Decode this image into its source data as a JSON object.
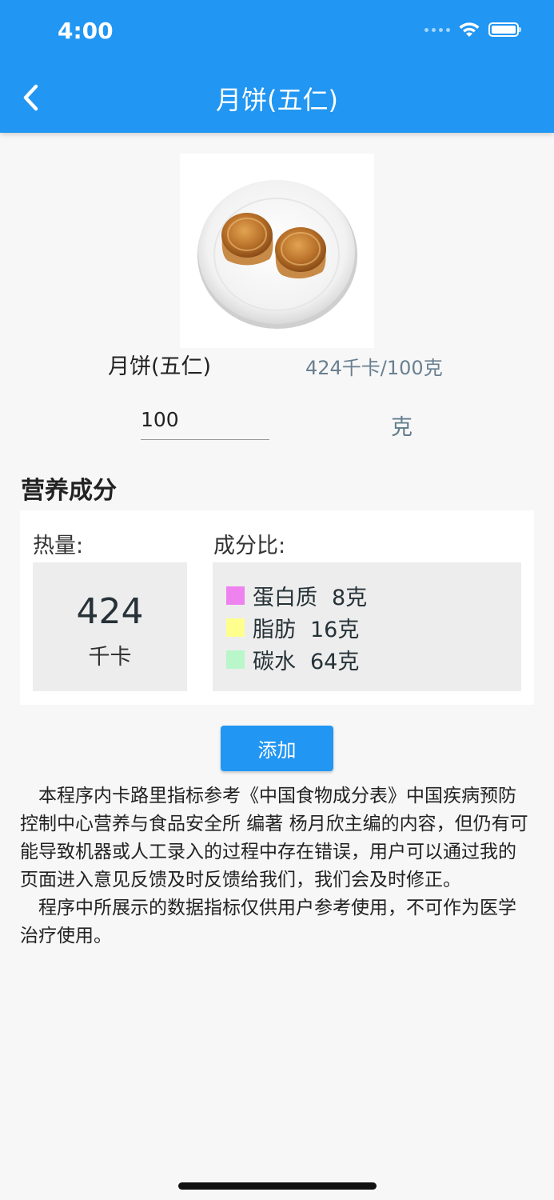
{
  "status_bar": {
    "time": "4:00"
  },
  "header": {
    "title": "月饼(五仁)"
  },
  "food": {
    "image_alt": "月饼(五仁)",
    "name": "月饼(五仁)",
    "calorie_per_100g": "424千卡/100克",
    "quantity_value": "100",
    "quantity_unit": "克"
  },
  "nutrition": {
    "section_title": "营养成分",
    "calorie_label": "热量:",
    "calorie_value": "424",
    "calorie_unit": "千卡",
    "ratio_label": "成分比:",
    "items": [
      {
        "name": "蛋白质",
        "amount": "8克",
        "color": "#ee82ee"
      },
      {
        "name": "脂肪",
        "amount": "16克",
        "color": "#ffff8d"
      },
      {
        "name": "碳水",
        "amount": "64克",
        "color": "#b9f6ca"
      }
    ]
  },
  "actions": {
    "add_label": "添加"
  },
  "disclaimer": {
    "paragraph1": "本程序内卡路里指标参考《中国食物成分表》中国疾病预防控制中心营养与食品安全所 编著 杨月欣主编的内容，但仍有可能导致机器或人工录入的过程中存在错误，用户可以通过我的页面进入意见反馈及时反馈给我们，我们会及时修正。",
    "paragraph2": "程序中所展示的数据指标仅供用户参考使用，不可作为医学治疗使用。"
  },
  "colors": {
    "primary": "#2196f3",
    "background": "#f7f7f8"
  }
}
